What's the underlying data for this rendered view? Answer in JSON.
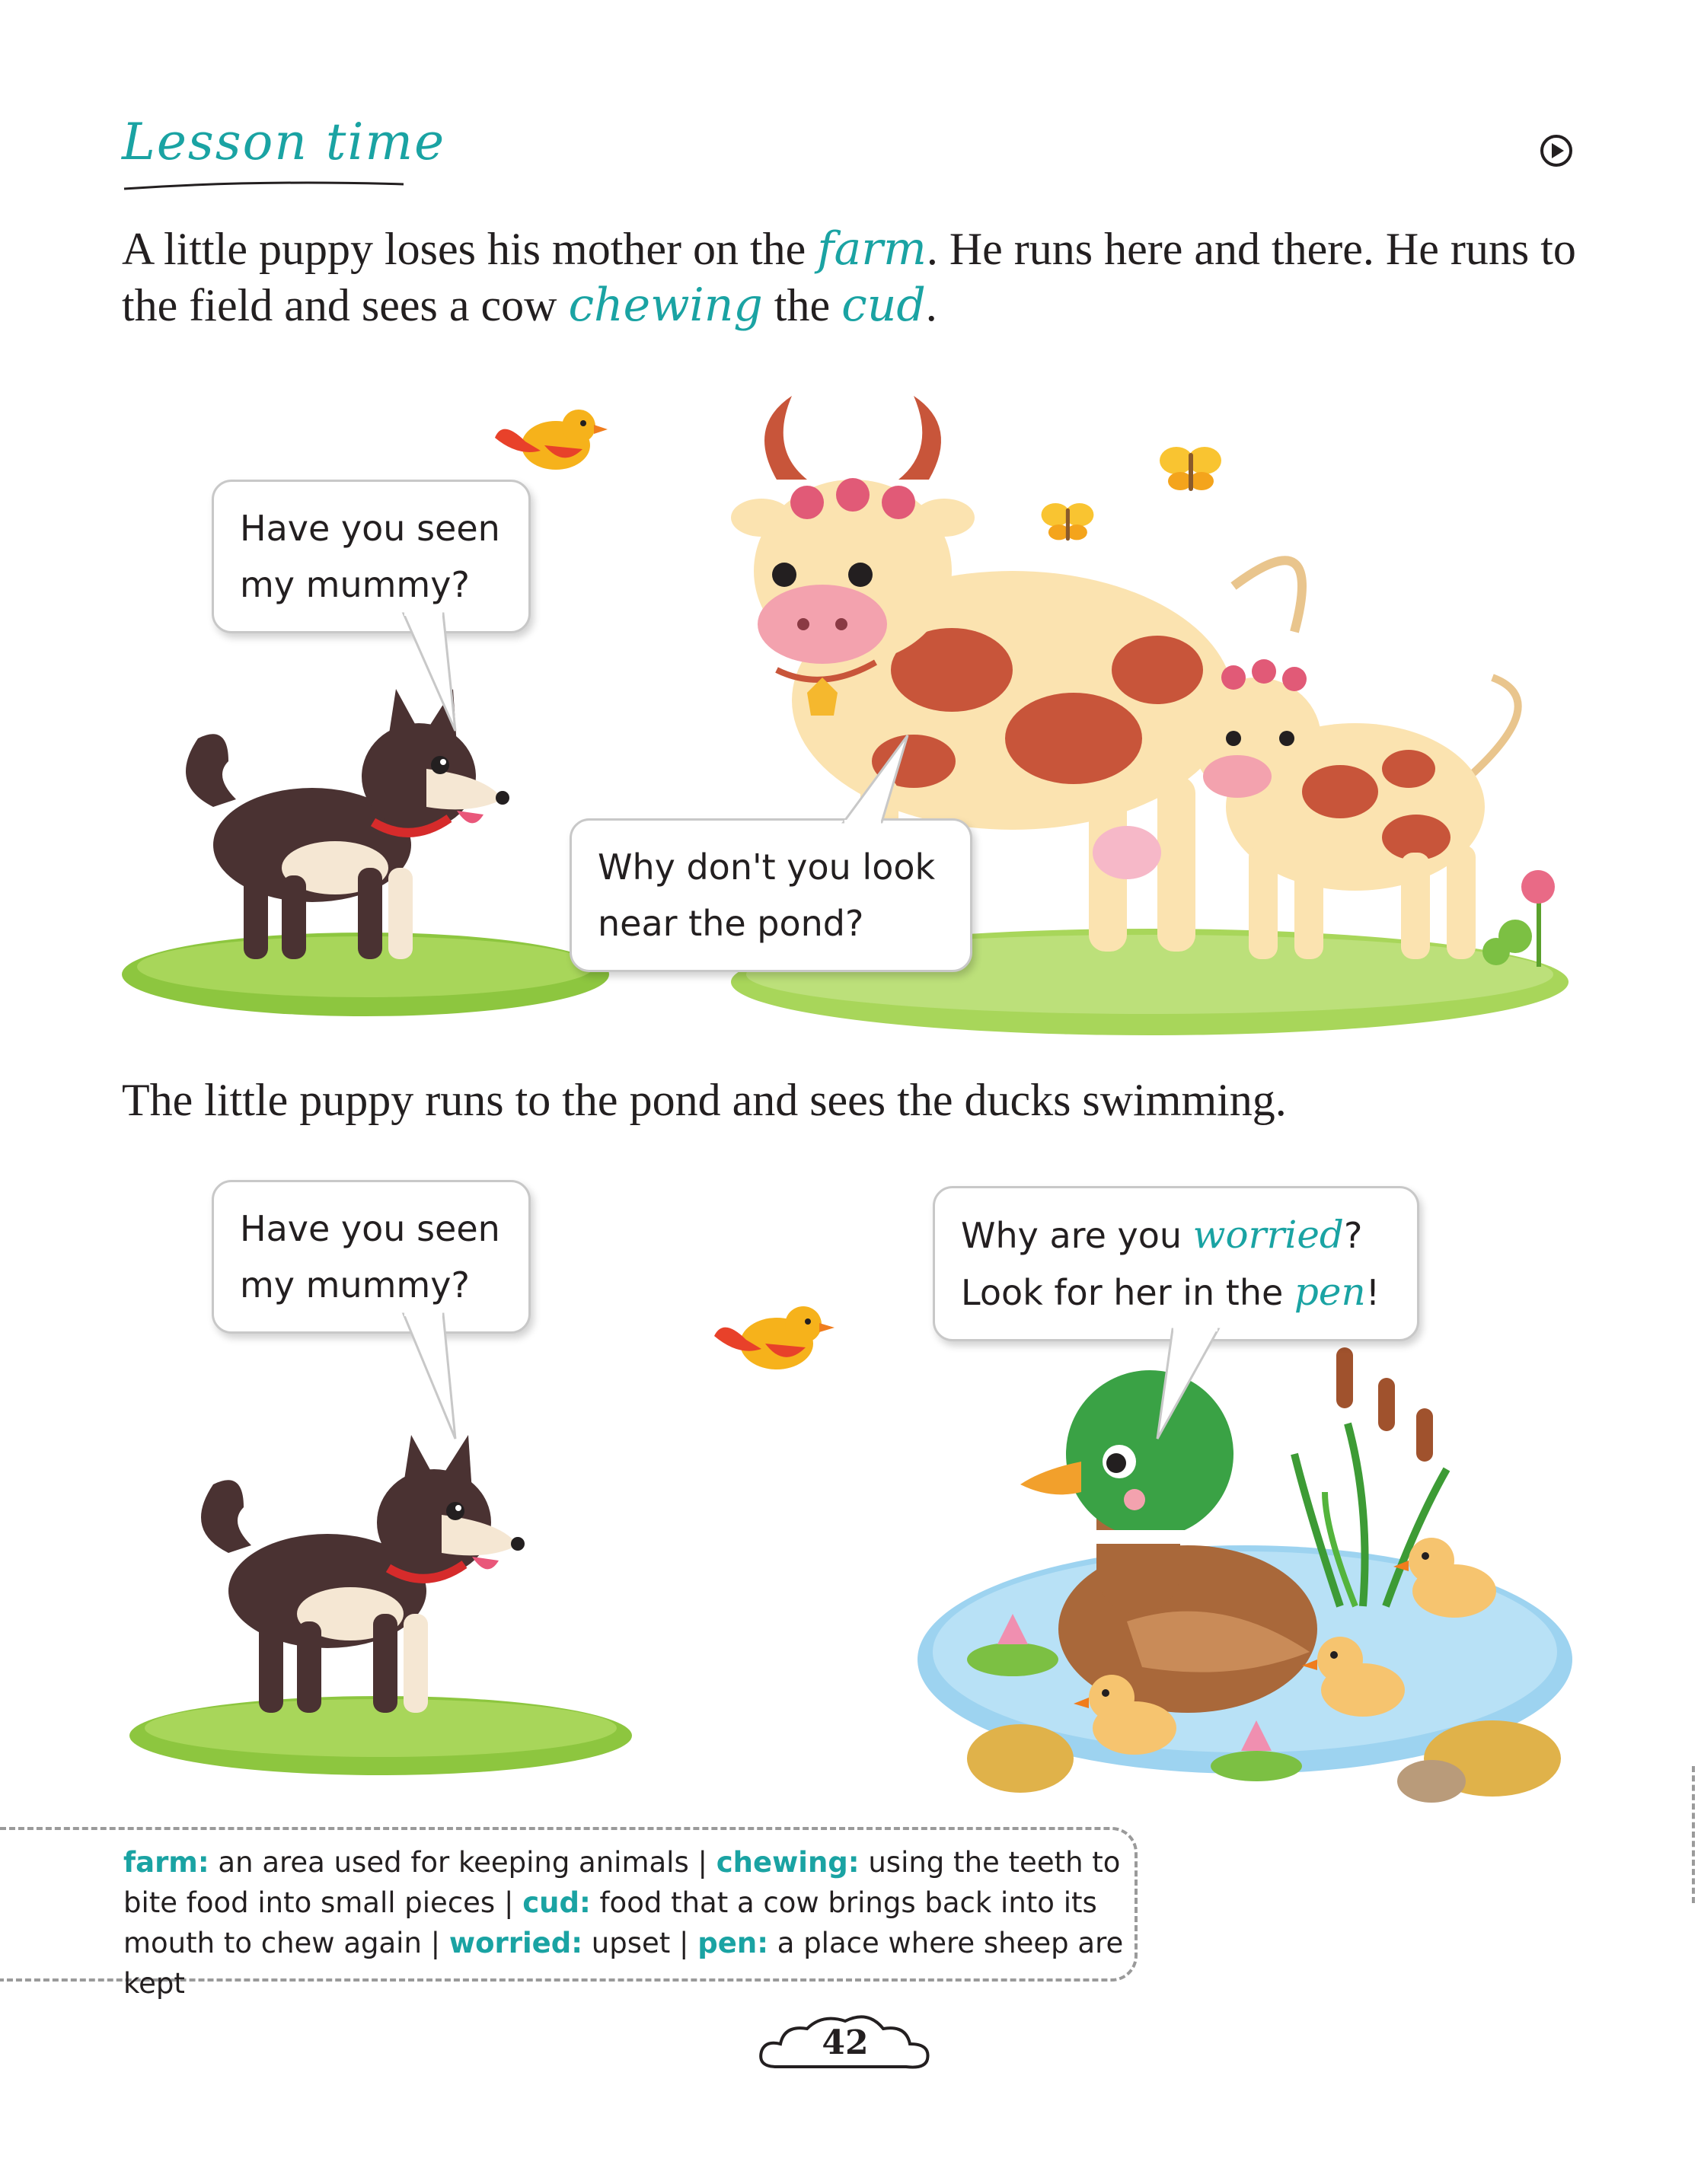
{
  "heading": "Lesson time",
  "paragraphs": {
    "p1": {
      "a": "A little puppy loses his mother on the ",
      "k1": "farm",
      "b": ". He runs here and there. He runs to the field and sees a cow ",
      "k2": "chewing",
      "c": " the ",
      "k3": "cud",
      "d": "."
    },
    "p2": "The little puppy runs to the pond and sees the ducks swimming."
  },
  "bubbles": {
    "puppy1": {
      "line1": "Have you seen",
      "line2": "my mummy?"
    },
    "cow": {
      "line1": "Why don't you look",
      "line2": "near the pond?"
    },
    "puppy2": {
      "line1": "Have you seen",
      "line2": "my mummy?"
    },
    "duck": {
      "a": "Why are you ",
      "k1": "worried",
      "b": "?",
      "c": "Look for her in the ",
      "k2": "pen",
      "d": "!"
    }
  },
  "glossary": [
    {
      "term": "farm:",
      "def": " an area used for keeping animals | "
    },
    {
      "term": "chewing:",
      "def": " using the teeth to bite food into small pieces | "
    },
    {
      "term": "cud:",
      "def": " food that a cow brings back into its mouth to chew again | "
    },
    {
      "term": "worried:",
      "def": " upset | "
    },
    {
      "term": "pen:",
      "def": " a place where sheep are kept"
    }
  ],
  "page_number": "42",
  "colors": {
    "accent": "#1aa3a3",
    "text": "#231f20",
    "grass": "#8dc63f",
    "cow_spot": "#c8553a",
    "puppy": "#4a3232"
  }
}
